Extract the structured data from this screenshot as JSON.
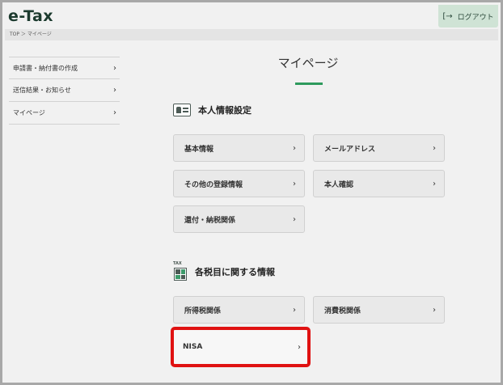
{
  "header": {
    "logo": "e-Tax",
    "logout_label": "ログアウト",
    "logout_icon": "[→"
  },
  "breadcrumb": "TOP ＞ マイページ",
  "sidebar": {
    "items": [
      {
        "label": "申請書・納付書の作成"
      },
      {
        "label": "送信結果・お知らせ"
      },
      {
        "label": "マイページ"
      }
    ]
  },
  "main": {
    "title": "マイページ",
    "sections": [
      {
        "heading": "本人情報設定",
        "buttons": [
          "基本情報",
          "メールアドレス",
          "その他の登録情報",
          "本人確認",
          "還付・納税関係"
        ]
      },
      {
        "heading": "各税目に関する情報",
        "icon_label": "TAX",
        "buttons": [
          "所得税関係",
          "消費税関係",
          "NISA"
        ]
      }
    ]
  },
  "chevron": "›",
  "colors": {
    "accent": "#2e9a5d",
    "highlight": "#e01212",
    "logout_bg": "#cfe3d5"
  }
}
